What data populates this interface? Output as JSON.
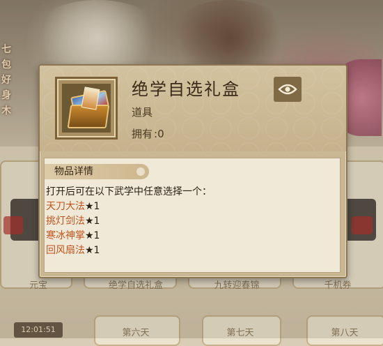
{
  "background": {
    "side_text": "七 包 好 身 木",
    "cells": [
      "元宝",
      "绝学自选礼盒",
      "九转迎春锦",
      "千机券"
    ],
    "days": [
      "第六天",
      "第七天",
      "第八天"
    ],
    "timer": "12:01:51"
  },
  "popup": {
    "title": "绝学自选礼盒",
    "type": "道具",
    "owned_label": "拥有",
    "owned_value": ":0",
    "eye_icon": "eye-icon",
    "section_title": "物品详情",
    "description": "打开后可在以下武学中任意选择一个：",
    "options": [
      {
        "name": "天刀大法",
        "qty": "★1"
      },
      {
        "name": "挑灯剑法",
        "qty": "★1"
      },
      {
        "name": "寒冰神掌",
        "qty": "★1"
      },
      {
        "name": "回风扇法",
        "qty": "★1"
      }
    ]
  },
  "colors": {
    "option_name": "#c0541e",
    "panel_bg": "#c9b794",
    "body_bg": "#f1e9d7"
  }
}
